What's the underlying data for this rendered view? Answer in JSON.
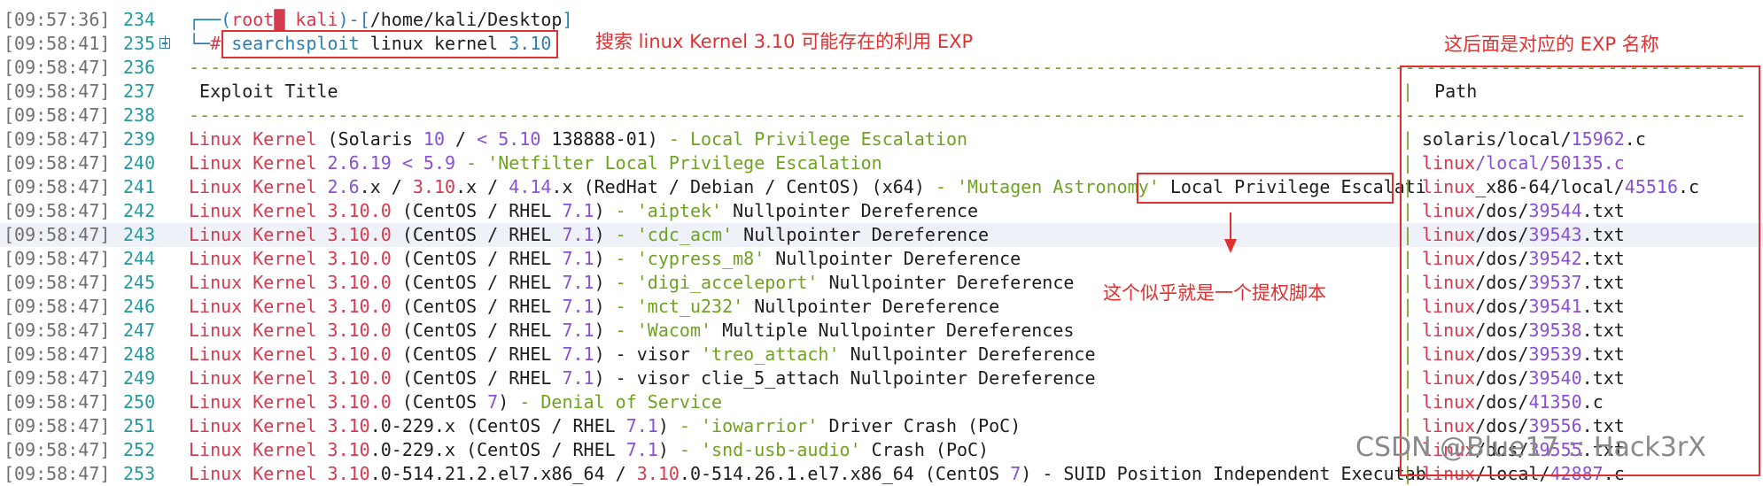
{
  "terminal": {
    "prompt": {
      "user": "root",
      "skull": "█",
      "host": "kali",
      "cwd": "/home/kali/Desktop"
    },
    "command": {
      "cmd": "searchsploit",
      "args": "linux kernel",
      "version": "3.10"
    },
    "header": {
      "title": "Exploit Title",
      "path": "Path"
    },
    "dash_line": "-----------------------------------------------------------------------------------------------------------------------------",
    "dash_line_path": "------------------------------------",
    "rows": [
      {
        "ts": "[09:57:36]",
        "ln": "234"
      },
      {
        "ts": "[09:58:41]",
        "ln": "235"
      },
      {
        "ts": "[09:58:47]",
        "ln": "236"
      },
      {
        "ts": "[09:58:47]",
        "ln": "237"
      },
      {
        "ts": "[09:58:47]",
        "ln": "238"
      },
      {
        "ts": "[09:58:47]",
        "ln": "239"
      },
      {
        "ts": "[09:58:47]",
        "ln": "240"
      },
      {
        "ts": "[09:58:47]",
        "ln": "241"
      },
      {
        "ts": "[09:58:47]",
        "ln": "242"
      },
      {
        "ts": "[09:58:47]",
        "ln": "243"
      },
      {
        "ts": "[09:58:47]",
        "ln": "244"
      },
      {
        "ts": "[09:58:47]",
        "ln": "245"
      },
      {
        "ts": "[09:58:47]",
        "ln": "246"
      },
      {
        "ts": "[09:58:47]",
        "ln": "247"
      },
      {
        "ts": "[09:58:47]",
        "ln": "248"
      },
      {
        "ts": "[09:58:47]",
        "ln": "249"
      },
      {
        "ts": "[09:58:47]",
        "ln": "250"
      },
      {
        "ts": "[09:58:47]",
        "ln": "251"
      },
      {
        "ts": "[09:58:47]",
        "ln": "252"
      },
      {
        "ts": "[09:58:47]",
        "ln": "253"
      }
    ],
    "results": [
      {
        "title": [
          [
            "r",
            "Linux Kernel"
          ],
          [
            "k",
            " (Solaris "
          ],
          [
            "v",
            "10"
          ],
          [
            "k",
            " / "
          ],
          [
            "v",
            "< 5.10"
          ],
          [
            "k",
            " 138888-01) "
          ],
          [
            "g",
            "- Local Privilege Escalation"
          ]
        ],
        "path": [
          [
            "k",
            "solaris/local/"
          ],
          [
            "v",
            "15962"
          ],
          [
            "k",
            ".c"
          ]
        ]
      },
      {
        "title": [
          [
            "r",
            "Linux Kernel"
          ],
          [
            "v",
            " 2.6.19"
          ],
          [
            "k",
            " "
          ],
          [
            "v",
            "< 5.9"
          ],
          [
            "k",
            " "
          ],
          [
            "g",
            "- 'Netfilter Local Privilege Escalation"
          ]
        ],
        "path": [
          [
            "r",
            "linux"
          ],
          [
            "v",
            "/local/50135.c"
          ]
        ]
      },
      {
        "title": [
          [
            "r",
            "Linux Kernel"
          ],
          [
            "k",
            " "
          ],
          [
            "v",
            "2.6"
          ],
          [
            "k",
            ".x / "
          ],
          [
            "r",
            "3.10"
          ],
          [
            "k",
            ".x / "
          ],
          [
            "v",
            "4.14"
          ],
          [
            "k",
            ".x (RedHat / Debian / CentOS) (x64) "
          ],
          [
            "g",
            "- 'Mutagen Astronomy' "
          ],
          [
            "k",
            "Local Privilege Escalati"
          ]
        ],
        "path": [
          [
            "r",
            "linux"
          ],
          [
            "k",
            "_x86-64/local/"
          ],
          [
            "v",
            "45516"
          ],
          [
            "k",
            ".c"
          ]
        ]
      },
      {
        "title": [
          [
            "r",
            "Linux Kernel 3.10.0"
          ],
          [
            "k",
            " (CentOS / RHEL "
          ],
          [
            "v",
            "7.1"
          ],
          [
            "k",
            ") "
          ],
          [
            "g",
            "- 'aiptek'"
          ],
          [
            "k",
            " Nullpointer Dereference"
          ]
        ],
        "path": [
          [
            "r",
            "linux"
          ],
          [
            "k",
            "/dos/"
          ],
          [
            "v",
            "39544"
          ],
          [
            "k",
            ".txt"
          ]
        ]
      },
      {
        "title": [
          [
            "r",
            "Linux Kernel 3.10.0"
          ],
          [
            "k",
            " (CentOS / RHEL "
          ],
          [
            "v",
            "7.1"
          ],
          [
            "k",
            ") "
          ],
          [
            "g",
            "- 'cdc_acm'"
          ],
          [
            "k",
            " Nullpointer Dereference"
          ]
        ],
        "path": [
          [
            "r",
            "linux"
          ],
          [
            "k",
            "/dos/"
          ],
          [
            "v",
            "39543"
          ],
          [
            "k",
            ".txt"
          ]
        ]
      },
      {
        "title": [
          [
            "r",
            "Linux Kernel 3.10.0"
          ],
          [
            "k",
            " (CentOS / RHEL "
          ],
          [
            "v",
            "7.1"
          ],
          [
            "k",
            ") "
          ],
          [
            "g",
            "- 'cypress_m8'"
          ],
          [
            "k",
            " Nullpointer Dereference"
          ]
        ],
        "path": [
          [
            "r",
            "linux"
          ],
          [
            "k",
            "/dos/"
          ],
          [
            "v",
            "39542"
          ],
          [
            "k",
            ".txt"
          ]
        ]
      },
      {
        "title": [
          [
            "r",
            "Linux Kernel 3.10.0"
          ],
          [
            "k",
            " (CentOS / RHEL "
          ],
          [
            "v",
            "7.1"
          ],
          [
            "k",
            ") "
          ],
          [
            "g",
            "- 'digi_acceleport'"
          ],
          [
            "k",
            " Nullpointer Dereference"
          ]
        ],
        "path": [
          [
            "r",
            "linux"
          ],
          [
            "k",
            "/dos/"
          ],
          [
            "v",
            "39537"
          ],
          [
            "k",
            ".txt"
          ]
        ]
      },
      {
        "title": [
          [
            "r",
            "Linux Kernel 3.10.0"
          ],
          [
            "k",
            " (CentOS / RHEL "
          ],
          [
            "v",
            "7.1"
          ],
          [
            "k",
            ") "
          ],
          [
            "g",
            "- 'mct_u232'"
          ],
          [
            "k",
            " Nullpointer Dereference"
          ]
        ],
        "path": [
          [
            "r",
            "linux"
          ],
          [
            "k",
            "/dos/"
          ],
          [
            "v",
            "39541"
          ],
          [
            "k",
            ".txt"
          ]
        ]
      },
      {
        "title": [
          [
            "r",
            "Linux Kernel 3.10.0"
          ],
          [
            "k",
            " (CentOS / RHEL "
          ],
          [
            "v",
            "7.1"
          ],
          [
            "k",
            ") "
          ],
          [
            "g",
            "- 'Wacom'"
          ],
          [
            "k",
            " Multiple Nullpointer Dereferences"
          ]
        ],
        "path": [
          [
            "r",
            "linux"
          ],
          [
            "k",
            "/dos/"
          ],
          [
            "v",
            "39538"
          ],
          [
            "k",
            ".txt"
          ]
        ]
      },
      {
        "title": [
          [
            "r",
            "Linux Kernel 3.10.0"
          ],
          [
            "k",
            " (CentOS / RHEL "
          ],
          [
            "v",
            "7.1"
          ],
          [
            "k",
            ") - visor "
          ],
          [
            "g",
            "'treo_attach'"
          ],
          [
            "k",
            " Nullpointer Dereference"
          ]
        ],
        "path": [
          [
            "r",
            "linux"
          ],
          [
            "k",
            "/dos/"
          ],
          [
            "v",
            "39539"
          ],
          [
            "k",
            ".txt"
          ]
        ]
      },
      {
        "title": [
          [
            "r",
            "Linux Kernel 3.10.0"
          ],
          [
            "k",
            " (CentOS / RHEL "
          ],
          [
            "v",
            "7.1"
          ],
          [
            "k",
            ") - visor clie_5_attach Nullpointer Dereference"
          ]
        ],
        "path": [
          [
            "r",
            "linux"
          ],
          [
            "k",
            "/dos/"
          ],
          [
            "v",
            "39540"
          ],
          [
            "k",
            ".txt"
          ]
        ]
      },
      {
        "title": [
          [
            "r",
            "Linux Kernel 3.10.0"
          ],
          [
            "k",
            " (CentOS "
          ],
          [
            "v",
            "7"
          ],
          [
            "k",
            ") "
          ],
          [
            "g",
            "- Denial of Service"
          ]
        ],
        "path": [
          [
            "r",
            "linux"
          ],
          [
            "k",
            "/dos/"
          ],
          [
            "v",
            "41350"
          ],
          [
            "k",
            ".c"
          ]
        ]
      },
      {
        "title": [
          [
            "r",
            "Linux Kernel 3.10"
          ],
          [
            "k",
            ".0-229.x (CentOS / RHEL "
          ],
          [
            "v",
            "7.1"
          ],
          [
            "k",
            ") "
          ],
          [
            "g",
            "- 'iowarrior'"
          ],
          [
            "k",
            " Driver Crash (PoC)"
          ]
        ],
        "path": [
          [
            "r",
            "linux"
          ],
          [
            "k",
            "/dos/"
          ],
          [
            "v",
            "39556"
          ],
          [
            "k",
            ".txt"
          ]
        ]
      },
      {
        "title": [
          [
            "r",
            "Linux Kernel 3.10"
          ],
          [
            "k",
            ".0-229.x (CentOS / RHEL "
          ],
          [
            "v",
            "7.1"
          ],
          [
            "k",
            ") "
          ],
          [
            "g",
            "- 'snd-usb-audio'"
          ],
          [
            "k",
            " Crash (PoC)"
          ]
        ],
        "path": [
          [
            "r",
            "linux"
          ],
          [
            "k",
            "/dos/"
          ],
          [
            "v",
            "39555"
          ],
          [
            "k",
            ".txt"
          ]
        ]
      },
      {
        "title": [
          [
            "r",
            "Linux Kernel 3.10"
          ],
          [
            "k",
            ".0-514.21.2.el7.x86_64 / "
          ],
          [
            "r",
            "3.10"
          ],
          [
            "k",
            ".0-514.26.1.el7.x86_64 (CentOS "
          ],
          [
            "v",
            "7"
          ],
          [
            "k",
            ") - SUID Position Independent Executab"
          ]
        ],
        "path": [
          [
            "r",
            "linux"
          ],
          [
            "k",
            "/local/"
          ],
          [
            "v",
            "42887"
          ],
          [
            "k",
            ".c"
          ]
        ]
      }
    ]
  },
  "annotations": {
    "search_note": "搜索 linux Kernel 3.10 可能存在的利用 EXP",
    "path_note": "这后面是对应的 EXP 名称",
    "exploit_note": "这个似乎就是一个提权脚本"
  },
  "watermark": "CSDN @Blue17 :: Hack3rX",
  "colors": {
    "accent_red": "#e03030",
    "kernel_red": "#d63a4e",
    "green": "#6ea321",
    "purple": "#8a4fd6",
    "blue": "#2a7fb5"
  }
}
